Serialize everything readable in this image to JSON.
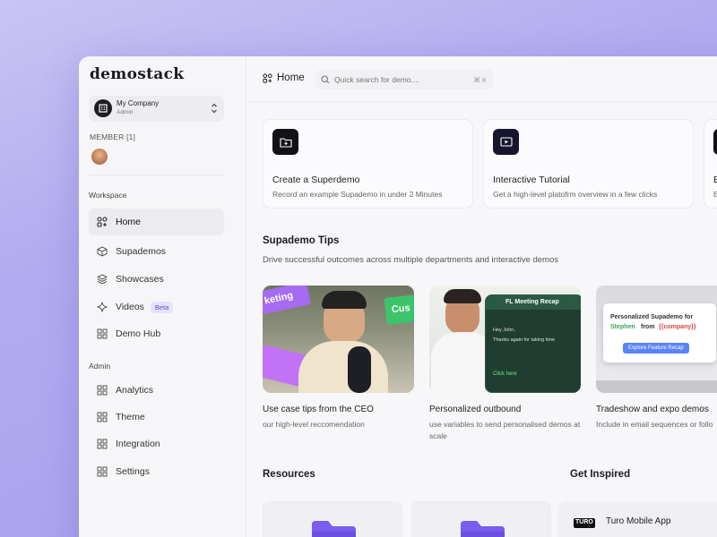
{
  "app": {
    "logo": "demostack"
  },
  "company": {
    "name": "My Company",
    "role": "Admin"
  },
  "member": {
    "label": "MEMBER [1]"
  },
  "sidebar": {
    "workspace_label": "Workspace",
    "items": [
      {
        "label": "Home",
        "icon": "home-grid-icon"
      },
      {
        "label": "Supademos",
        "icon": "cube-icon"
      },
      {
        "label": "Showcases",
        "icon": "layers-icon"
      },
      {
        "label": "Videos",
        "icon": "sparkle-icon",
        "badge": "Beta"
      },
      {
        "label": "Demo Hub",
        "icon": "grid-icon"
      }
    ],
    "admin_label": "Admin",
    "admin_items": [
      {
        "label": "Analytics",
        "icon": "grid-icon"
      },
      {
        "label": "Theme",
        "icon": "grid-icon"
      },
      {
        "label": "Integration",
        "icon": "grid-icon"
      },
      {
        "label": "Settings",
        "icon": "grid-icon"
      }
    ]
  },
  "header": {
    "breadcrumb": "Home",
    "search_placeholder": "Quick search for demo....",
    "search_shortcut": "⌘ K"
  },
  "cards": [
    {
      "title": "Create a Superdemo",
      "desc": "Record an example Supademo in under 2 Minutes",
      "icon": "folder-plus-icon"
    },
    {
      "title": "Interactive Tutorial",
      "desc": "Get a high-level platofrm overview in a few clicks",
      "icon": "play-screen-icon"
    },
    {
      "title": "B",
      "desc": "E",
      "icon": "partial-icon"
    }
  ],
  "tips": {
    "title": "Supademo Tips",
    "subtitle": "Drive successful outcomes across multiple departments and interactive demos",
    "items": [
      {
        "title": "Use case tips from the CEO",
        "desc": "our high-level reccomendation",
        "bubbles": [
          "keting",
          "Cus"
        ]
      },
      {
        "title": "Personalized outbound",
        "desc": "use variables to send personalised demos at scale",
        "email": {
          "subject": "FL Meeting Recap",
          "line1": "Hey John,",
          "line2": "Thanks again for taking time",
          "link": "Click here"
        }
      },
      {
        "title": "Tradeshow and expo demos",
        "desc": "Include in email sequences or follo",
        "card": {
          "line1": "Personalized Supademo for",
          "name": "Stephen",
          "from": "from",
          "var": "{{company}}",
          "button": "Explore Feature Recap"
        }
      }
    ]
  },
  "resources": {
    "title": "Resources"
  },
  "inspired": {
    "title": "Get Inspired",
    "item": "Turo Mobile App",
    "logo": "TURO"
  },
  "colors": {
    "accent": "#6b4fe0",
    "folder": "#7a5cf0",
    "beta_bg": "#e5e2fb"
  }
}
